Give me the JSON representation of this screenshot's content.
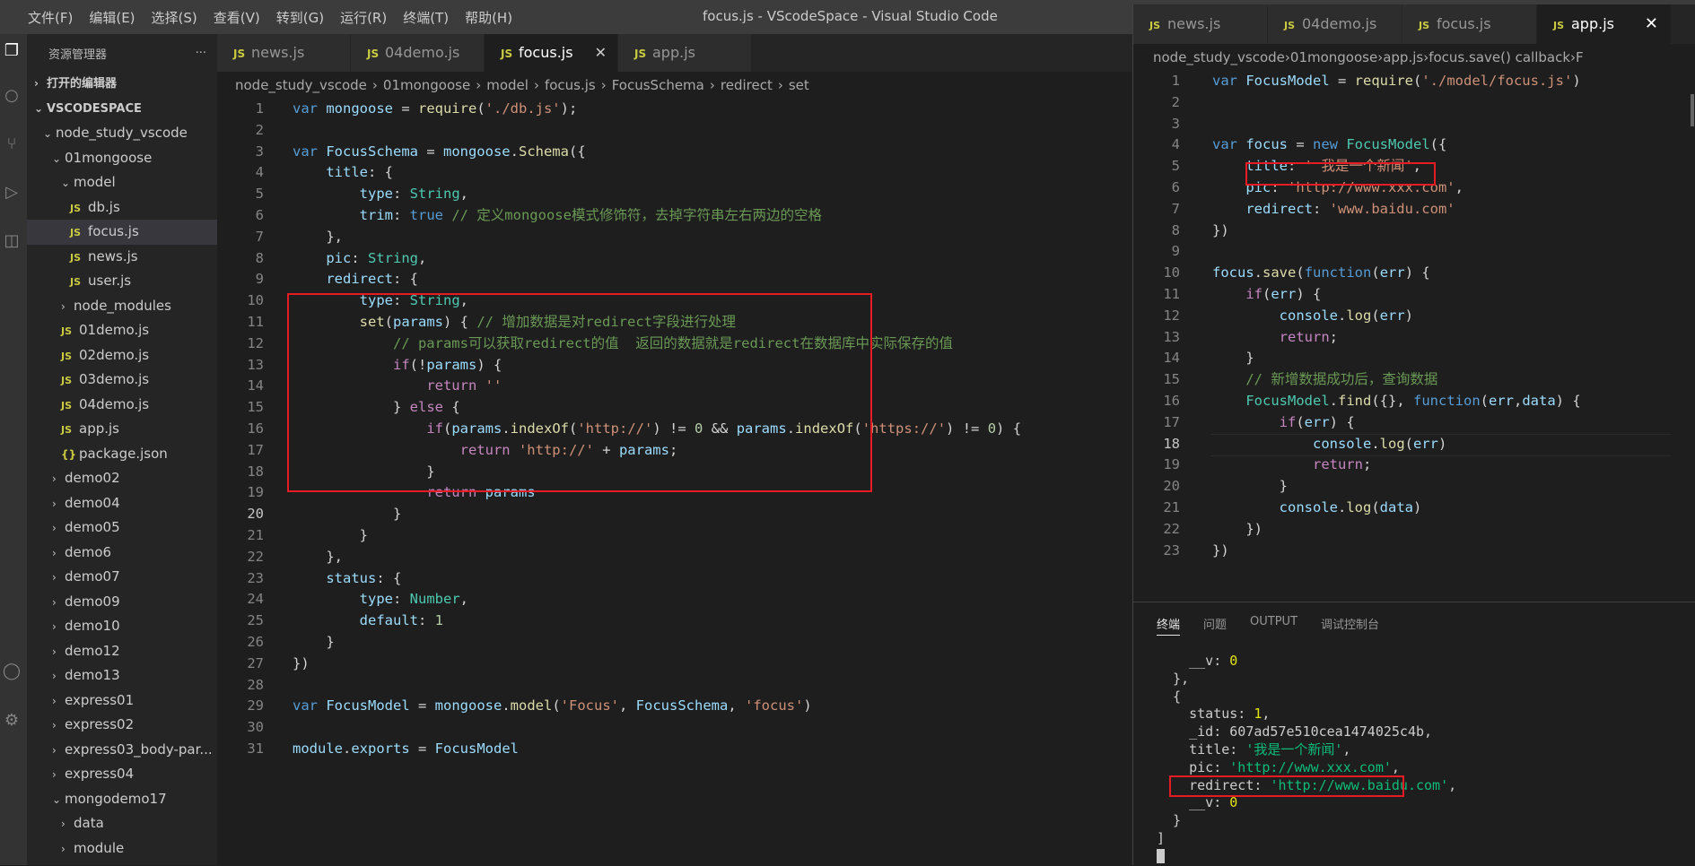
{
  "menu": [
    "文件(F)",
    "编辑(E)",
    "选择(S)",
    "查看(V)",
    "转到(G)",
    "运行(R)",
    "终端(T)",
    "帮助(H)"
  ],
  "window_title": "focus.js - VScodeSpace - Visual Studio Code",
  "sidebar": {
    "title": "资源管理器",
    "more": "···",
    "open_editors": "打开的编辑器",
    "workspace": "VSCODESPACE",
    "items": [
      {
        "label": "node_study_vscode",
        "type": "folder-open",
        "indent": 1
      },
      {
        "label": "01mongoose",
        "type": "folder-open",
        "indent": 2
      },
      {
        "label": "model",
        "type": "folder-open",
        "indent": 3
      },
      {
        "label": "db.js",
        "type": "js",
        "indent": 4
      },
      {
        "label": "focus.js",
        "type": "js",
        "indent": 4,
        "selected": true
      },
      {
        "label": "news.js",
        "type": "js",
        "indent": 4
      },
      {
        "label": "user.js",
        "type": "js",
        "indent": 4
      },
      {
        "label": "node_modules",
        "type": "folder",
        "indent": 3
      },
      {
        "label": "01demo.js",
        "type": "js",
        "indent": 3
      },
      {
        "label": "02demo.js",
        "type": "js",
        "indent": 3
      },
      {
        "label": "03demo.js",
        "type": "js",
        "indent": 3
      },
      {
        "label": "04demo.js",
        "type": "js",
        "indent": 3
      },
      {
        "label": "app.js",
        "type": "js",
        "indent": 3
      },
      {
        "label": "package.json",
        "type": "json",
        "indent": 3
      },
      {
        "label": "demo02",
        "type": "folder",
        "indent": 2
      },
      {
        "label": "demo04",
        "type": "folder",
        "indent": 2
      },
      {
        "label": "demo05",
        "type": "folder",
        "indent": 2
      },
      {
        "label": "demo6",
        "type": "folder",
        "indent": 2
      },
      {
        "label": "demo07",
        "type": "folder",
        "indent": 2
      },
      {
        "label": "demo09",
        "type": "folder",
        "indent": 2
      },
      {
        "label": "demo10",
        "type": "folder",
        "indent": 2
      },
      {
        "label": "demo12",
        "type": "folder",
        "indent": 2
      },
      {
        "label": "demo13",
        "type": "folder",
        "indent": 2
      },
      {
        "label": "express01",
        "type": "folder",
        "indent": 2
      },
      {
        "label": "express02",
        "type": "folder",
        "indent": 2
      },
      {
        "label": "express03_body-par...",
        "type": "folder",
        "indent": 2
      },
      {
        "label": "express04",
        "type": "folder",
        "indent": 2
      },
      {
        "label": "mongodemo17",
        "type": "folder-open",
        "indent": 2
      },
      {
        "label": "data",
        "type": "folder",
        "indent": 3
      },
      {
        "label": "module",
        "type": "folder",
        "indent": 3
      }
    ]
  },
  "left_editor": {
    "tabs": [
      {
        "label": "news.js",
        "active": false
      },
      {
        "label": "04demo.js",
        "active": false
      },
      {
        "label": "focus.js",
        "active": true,
        "close": "✕"
      },
      {
        "label": "app.js",
        "active": false
      }
    ],
    "breadcrumb": [
      "node_study_vscode",
      "01mongoose",
      "model",
      "focus.js",
      "FocusSchema",
      "redirect",
      "set"
    ],
    "current_line": 20,
    "lines": [
      [
        [
          "kw",
          "var "
        ],
        [
          "var",
          "mongoose"
        ],
        [
          "pl",
          " = "
        ],
        [
          "fn",
          "require"
        ],
        [
          "pl",
          "("
        ],
        [
          "str",
          "'./db.js'"
        ],
        [
          "pl",
          ");"
        ]
      ],
      [],
      [
        [
          "kw",
          "var "
        ],
        [
          "var",
          "FocusSchema"
        ],
        [
          "pl",
          " = "
        ],
        [
          "var",
          "mongoose"
        ],
        [
          "pl",
          "."
        ],
        [
          "fn",
          "Schema"
        ],
        [
          "pl",
          "({"
        ]
      ],
      [
        [
          "pl",
          "    "
        ],
        [
          "var",
          "title"
        ],
        [
          "pl",
          ": {"
        ]
      ],
      [
        [
          "pl",
          "        "
        ],
        [
          "var",
          "type"
        ],
        [
          "pl",
          ": "
        ],
        [
          "cls",
          "String"
        ],
        [
          "pl",
          ","
        ]
      ],
      [
        [
          "pl",
          "        "
        ],
        [
          "var",
          "trim"
        ],
        [
          "pl",
          ": "
        ],
        [
          "kw",
          "true"
        ],
        [
          "cm",
          " // 定义mongoose模式修饰符，去掉字符串左右两边的空格"
        ]
      ],
      [
        [
          "pl",
          "    },"
        ]
      ],
      [
        [
          "pl",
          "    "
        ],
        [
          "var",
          "pic"
        ],
        [
          "pl",
          ": "
        ],
        [
          "cls",
          "String"
        ],
        [
          "pl",
          ","
        ]
      ],
      [
        [
          "pl",
          "    "
        ],
        [
          "var",
          "redirect"
        ],
        [
          "pl",
          ": {"
        ]
      ],
      [
        [
          "pl",
          "        "
        ],
        [
          "var",
          "type"
        ],
        [
          "pl",
          ": "
        ],
        [
          "cls",
          "String"
        ],
        [
          "pl",
          ","
        ]
      ],
      [
        [
          "pl",
          "        "
        ],
        [
          "fn",
          "set"
        ],
        [
          "pl",
          "("
        ],
        [
          "var",
          "params"
        ],
        [
          "pl",
          ") { "
        ],
        [
          "cm",
          "// 增加数据是对redirect字段进行处理"
        ]
      ],
      [
        [
          "pl",
          "            "
        ],
        [
          "cm",
          "// params可以获取redirect的值  返回的数据就是redirect在数据库中实际保存的值"
        ]
      ],
      [
        [
          "pl",
          "            "
        ],
        [
          "ctl",
          "if"
        ],
        [
          "pl",
          "(!"
        ],
        [
          "var",
          "params"
        ],
        [
          "pl",
          ") {"
        ]
      ],
      [
        [
          "pl",
          "                "
        ],
        [
          "ctl",
          "return "
        ],
        [
          "str",
          "''"
        ]
      ],
      [
        [
          "pl",
          "            } "
        ],
        [
          "ctl",
          "else"
        ],
        [
          "pl",
          " {"
        ]
      ],
      [
        [
          "pl",
          "                "
        ],
        [
          "ctl",
          "if"
        ],
        [
          "pl",
          "("
        ],
        [
          "var",
          "params"
        ],
        [
          "pl",
          "."
        ],
        [
          "fn",
          "indexOf"
        ],
        [
          "pl",
          "("
        ],
        [
          "str",
          "'http://'"
        ],
        [
          "pl",
          ") != "
        ],
        [
          "num",
          "0"
        ],
        [
          "pl",
          " && "
        ],
        [
          "var",
          "params"
        ],
        [
          "pl",
          "."
        ],
        [
          "fn",
          "indexOf"
        ],
        [
          "pl",
          "("
        ],
        [
          "str",
          "'https://'"
        ],
        [
          "pl",
          ") != "
        ],
        [
          "num",
          "0"
        ],
        [
          "pl",
          ") {"
        ]
      ],
      [
        [
          "pl",
          "                    "
        ],
        [
          "ctl",
          "return "
        ],
        [
          "str",
          "'http://'"
        ],
        [
          "pl",
          " + "
        ],
        [
          "var",
          "params"
        ],
        [
          "pl",
          ";"
        ]
      ],
      [
        [
          "pl",
          "                }"
        ]
      ],
      [
        [
          "pl",
          "                "
        ],
        [
          "ctl",
          "return "
        ],
        [
          "var",
          "params"
        ]
      ],
      [
        [
          "pl",
          "            }"
        ]
      ],
      [
        [
          "pl",
          "        }"
        ]
      ],
      [
        [
          "pl",
          "    },"
        ]
      ],
      [
        [
          "pl",
          "    "
        ],
        [
          "var",
          "status"
        ],
        [
          "pl",
          ": {"
        ]
      ],
      [
        [
          "pl",
          "        "
        ],
        [
          "var",
          "type"
        ],
        [
          "pl",
          ": "
        ],
        [
          "cls",
          "Number"
        ],
        [
          "pl",
          ","
        ]
      ],
      [
        [
          "pl",
          "        "
        ],
        [
          "var",
          "default"
        ],
        [
          "pl",
          ": "
        ],
        [
          "num",
          "1"
        ]
      ],
      [
        [
          "pl",
          "    }"
        ]
      ],
      [
        [
          "pl",
          "})"
        ]
      ],
      [],
      [
        [
          "kw",
          "var "
        ],
        [
          "var",
          "FocusModel"
        ],
        [
          "pl",
          " = "
        ],
        [
          "var",
          "mongoose"
        ],
        [
          "pl",
          "."
        ],
        [
          "fn",
          "model"
        ],
        [
          "pl",
          "("
        ],
        [
          "str",
          "'Focus'"
        ],
        [
          "pl",
          ", "
        ],
        [
          "var",
          "FocusSchema"
        ],
        [
          "pl",
          ", "
        ],
        [
          "str",
          "'focus'"
        ],
        [
          "pl",
          ")"
        ]
      ],
      [],
      [
        [
          "var",
          "module"
        ],
        [
          "pl",
          "."
        ],
        [
          "var",
          "exports"
        ],
        [
          "pl",
          " = "
        ],
        [
          "var",
          "FocusModel"
        ]
      ]
    ]
  },
  "right_editor": {
    "tabs": [
      {
        "label": "news.js",
        "active": false
      },
      {
        "label": "04demo.js",
        "active": false
      },
      {
        "label": "focus.js",
        "active": false
      },
      {
        "label": "app.js",
        "active": true,
        "close": "✕"
      }
    ],
    "breadcrumb": [
      "node_study_vscode",
      "01mongoose",
      "app.js",
      "focus.save() callback",
      "F"
    ],
    "current_line": 18,
    "lines": [
      [
        [
          "kw",
          "var "
        ],
        [
          "var",
          "FocusModel"
        ],
        [
          "pl",
          " = "
        ],
        [
          "fn",
          "require"
        ],
        [
          "pl",
          "("
        ],
        [
          "str",
          "'./model/focus.js'"
        ],
        [
          "pl",
          ")"
        ]
      ],
      [],
      [],
      [
        [
          "kw",
          "var "
        ],
        [
          "var",
          "focus"
        ],
        [
          "pl",
          " = "
        ],
        [
          "kw",
          "new "
        ],
        [
          "cls",
          "FocusModel"
        ],
        [
          "pl",
          "({"
        ]
      ],
      [
        [
          "pl",
          "    "
        ],
        [
          "var",
          "title"
        ],
        [
          "pl",
          ": "
        ],
        [
          "str",
          "' 我是一个新闻'"
        ],
        [
          "pl",
          ","
        ]
      ],
      [
        [
          "pl",
          "    "
        ],
        [
          "var",
          "pic"
        ],
        [
          "pl",
          ": "
        ],
        [
          "str",
          "'http://www.xxx.com'"
        ],
        [
          "pl",
          ","
        ]
      ],
      [
        [
          "pl",
          "    "
        ],
        [
          "var",
          "redirect"
        ],
        [
          "pl",
          ": "
        ],
        [
          "str",
          "'www.baidu.com'"
        ]
      ],
      [
        [
          "pl",
          "})"
        ]
      ],
      [],
      [
        [
          "var",
          "focus"
        ],
        [
          "pl",
          "."
        ],
        [
          "fn",
          "save"
        ],
        [
          "pl",
          "("
        ],
        [
          "kw",
          "function"
        ],
        [
          "pl",
          "("
        ],
        [
          "var",
          "err"
        ],
        [
          "pl",
          ") {"
        ]
      ],
      [
        [
          "pl",
          "    "
        ],
        [
          "ctl",
          "if"
        ],
        [
          "pl",
          "("
        ],
        [
          "var",
          "err"
        ],
        [
          "pl",
          ") {"
        ]
      ],
      [
        [
          "pl",
          "        "
        ],
        [
          "var",
          "console"
        ],
        [
          "pl",
          "."
        ],
        [
          "fn",
          "log"
        ],
        [
          "pl",
          "("
        ],
        [
          "var",
          "err"
        ],
        [
          "pl",
          ")"
        ]
      ],
      [
        [
          "pl",
          "        "
        ],
        [
          "ctl",
          "return"
        ],
        [
          "pl",
          ";"
        ]
      ],
      [
        [
          "pl",
          "    }"
        ]
      ],
      [
        [
          "pl",
          "    "
        ],
        [
          "cm",
          "// 新增数据成功后，查询数据"
        ]
      ],
      [
        [
          "pl",
          "    "
        ],
        [
          "cls",
          "FocusModel"
        ],
        [
          "pl",
          "."
        ],
        [
          "fn",
          "find"
        ],
        [
          "pl",
          "({}, "
        ],
        [
          "kw",
          "function"
        ],
        [
          "pl",
          "("
        ],
        [
          "var",
          "err"
        ],
        [
          "pl",
          ","
        ],
        [
          "var",
          "data"
        ],
        [
          "pl",
          ") {"
        ]
      ],
      [
        [
          "pl",
          "        "
        ],
        [
          "ctl",
          "if"
        ],
        [
          "pl",
          "("
        ],
        [
          "var",
          "err"
        ],
        [
          "pl",
          ") {"
        ]
      ],
      [
        [
          "pl",
          "            "
        ],
        [
          "var",
          "console"
        ],
        [
          "pl",
          "."
        ],
        [
          "fn",
          "log"
        ],
        [
          "pl",
          "("
        ],
        [
          "var",
          "err"
        ],
        [
          "pl",
          ")"
        ]
      ],
      [
        [
          "pl",
          "            "
        ],
        [
          "ctl",
          "return"
        ],
        [
          "pl",
          ";"
        ]
      ],
      [
        [
          "pl",
          "        }"
        ]
      ],
      [
        [
          "pl",
          "        "
        ],
        [
          "var",
          "console"
        ],
        [
          "pl",
          "."
        ],
        [
          "fn",
          "log"
        ],
        [
          "pl",
          "("
        ],
        [
          "var",
          "data"
        ],
        [
          "pl",
          ")"
        ]
      ],
      [
        [
          "pl",
          "    })"
        ]
      ],
      [
        [
          "pl",
          "})"
        ]
      ]
    ]
  },
  "panel": {
    "tabs": [
      "终端",
      "问题",
      "OUTPUT",
      "调试控制台"
    ],
    "active_tab": "终端",
    "terminal": [
      [
        [
          "pl",
          "    __v: "
        ],
        [
          "num",
          "0"
        ]
      ],
      [
        [
          "pl",
          "  },"
        ]
      ],
      [
        [
          "pl",
          "  {"
        ]
      ],
      [
        [
          "pl",
          "    status: "
        ],
        [
          "num",
          "1"
        ],
        [
          "pl",
          ","
        ]
      ],
      [
        [
          "pl",
          "    _id: 607ad57e510cea1474025c4b,"
        ]
      ],
      [
        [
          "pl",
          "    title: "
        ],
        [
          "str",
          "'我是一个新闻'"
        ],
        [
          "pl",
          ","
        ]
      ],
      [
        [
          "pl",
          "    pic: "
        ],
        [
          "str",
          "'http://www.xxx.com'"
        ],
        [
          "pl",
          ","
        ]
      ],
      [
        [
          "pl",
          "    redirect: "
        ],
        [
          "str",
          "'http://www.baidu.com'"
        ],
        [
          "pl",
          ","
        ]
      ],
      [
        [
          "pl",
          "    __v: "
        ],
        [
          "num",
          "0"
        ]
      ],
      [
        [
          "pl",
          "  }"
        ]
      ],
      [
        [
          "pl",
          "]"
        ]
      ]
    ]
  },
  "colors": {
    "highlight_box": "#e51c23",
    "accent_js": "#cbcb41"
  }
}
